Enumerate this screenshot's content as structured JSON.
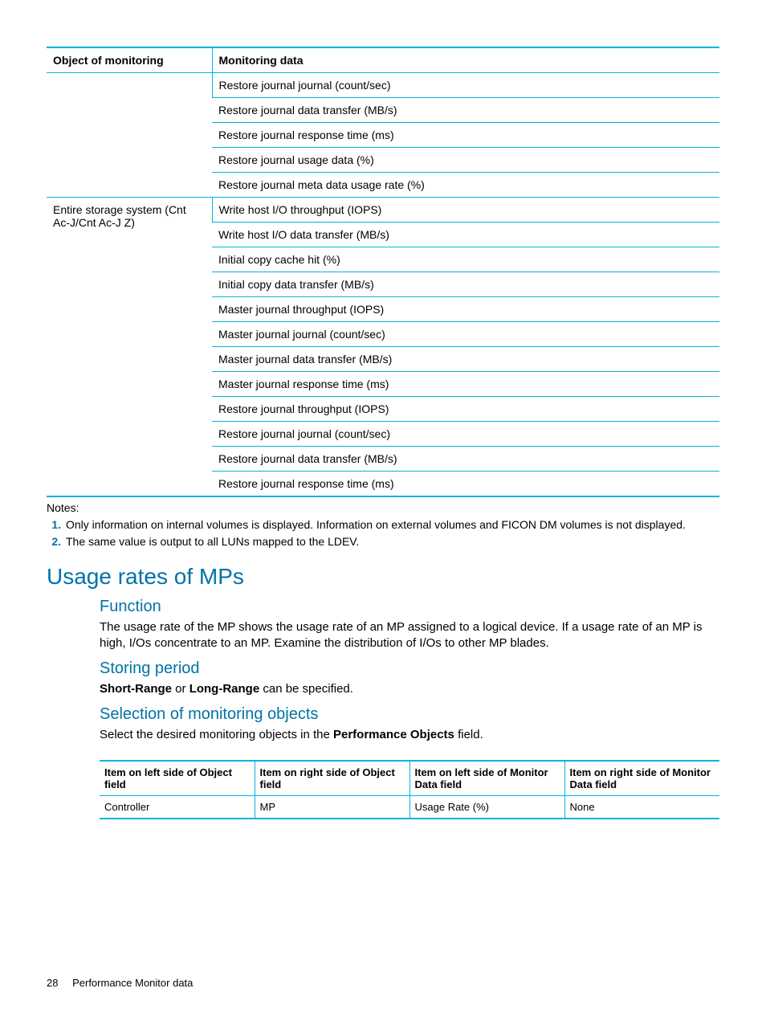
{
  "table1": {
    "headers": [
      "Object of monitoring",
      "Monitoring data"
    ],
    "group1": {
      "object": "",
      "items": [
        "Restore journal journal (count/sec)",
        "Restore journal data transfer (MB/s)",
        "Restore journal response time (ms)",
        "Restore journal usage data (%)",
        "Restore journal meta data usage rate (%)"
      ]
    },
    "group2": {
      "object": "Entire storage system (Cnt Ac-J/Cnt Ac-J Z)",
      "items": [
        "Write host I/O throughput (IOPS)",
        "Write host I/O data transfer (MB/s)",
        "Initial copy cache hit (%)",
        "Initial copy data transfer (MB/s)",
        "Master journal throughput (IOPS)",
        "Master journal journal (count/sec)",
        "Master journal data transfer (MB/s)",
        "Master journal response time (ms)",
        "Restore journal throughput (IOPS)",
        "Restore journal journal (count/sec)",
        "Restore journal data transfer (MB/s)",
        "Restore journal response time (ms)"
      ]
    }
  },
  "notes": {
    "label": "Notes:",
    "items": [
      "Only information on internal volumes is displayed. Information on external volumes and FICON DM volumes is not displayed.",
      "The same value is output to all LUNs mapped to the LDEV."
    ]
  },
  "section": {
    "title": "Usage rates of MPs",
    "function": {
      "heading": "Function",
      "body": "The usage rate of the MP shows the usage rate of an MP assigned to a logical device. If a usage rate of an MP is high, I/Os concentrate to an MP. Examine the distribution of I/Os to other MP blades."
    },
    "storing": {
      "heading": "Storing period",
      "prefix": "Short-Range",
      "mid": " or ",
      "bold2": "Long-Range",
      "suffix": " can be specified."
    },
    "selection": {
      "heading": "Selection of monitoring objects",
      "intro_pre": "Select the desired monitoring objects in the ",
      "intro_bold": "Performance Objects",
      "intro_post": " field.",
      "headers": [
        "Item on left side of Object field",
        "Item on right side of Object field",
        "Item on left side of Monitor Data field",
        "Item on right side of Monitor Data field"
      ],
      "row": [
        "Controller",
        "MP",
        "Usage Rate (%)",
        "None"
      ]
    }
  },
  "footer": {
    "page": "28",
    "title": "Performance Monitor data"
  }
}
